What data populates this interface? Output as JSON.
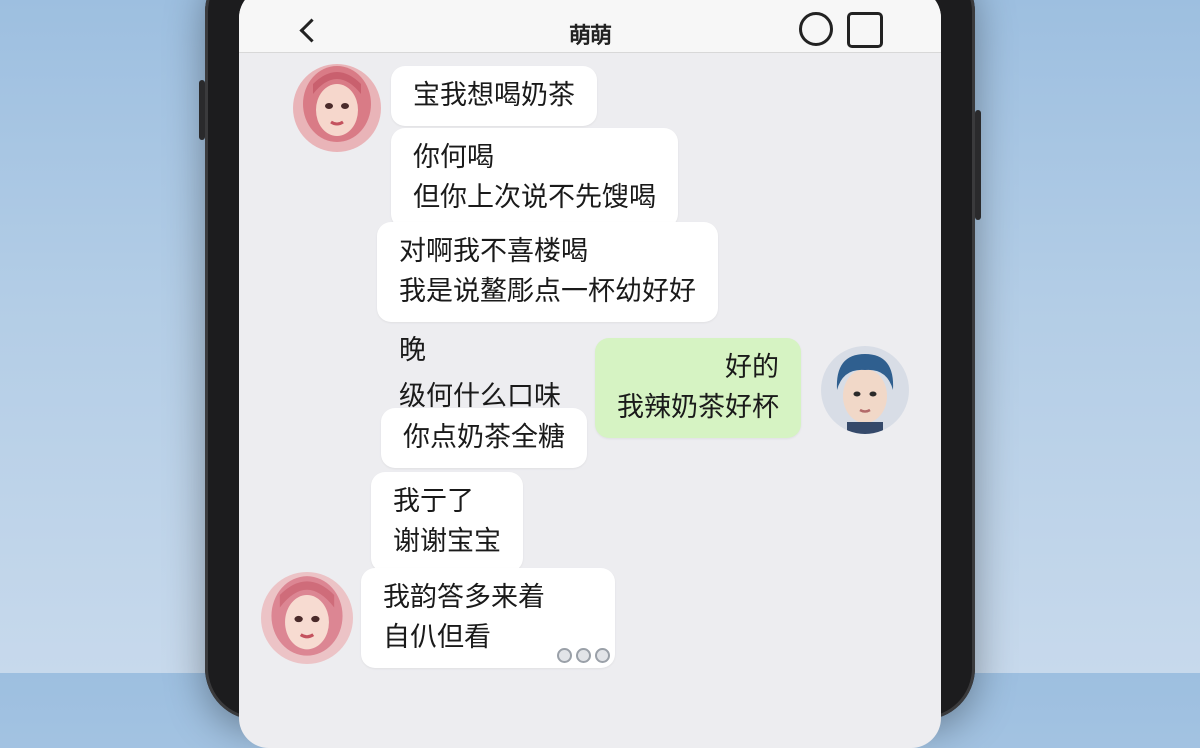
{
  "header": {
    "title": "萌萌"
  },
  "messages": [
    {
      "lines": [
        "宝我想喝奶茶"
      ]
    },
    {
      "lines": [
        "你何喝",
        "但你上次说不先馊喝"
      ]
    },
    {
      "lines": [
        "对啊我不喜楼喝",
        "我是说鳌彫点一杯幼好好"
      ]
    },
    {
      "lines": [
        "晚",
        "级何什么口味"
      ]
    },
    {
      "lines": [
        "好的",
        "我辣奶茶好杯"
      ]
    },
    {
      "lines": [
        "你点奶茶全糖"
      ]
    },
    {
      "lines": [
        "我亍了",
        "谢谢宝宝"
      ]
    },
    {
      "lines": [
        "我韵答多来着",
        "自仈但看"
      ]
    }
  ],
  "colors": {
    "self_bubble": "#d6f3c3",
    "other_bubble": "#ffffff",
    "chat_bg": "#ededf0"
  },
  "icons": {
    "back": "chevron-left-icon",
    "call": "circle-icon",
    "more": "square-icon",
    "typing": "typing-dots-icon"
  }
}
